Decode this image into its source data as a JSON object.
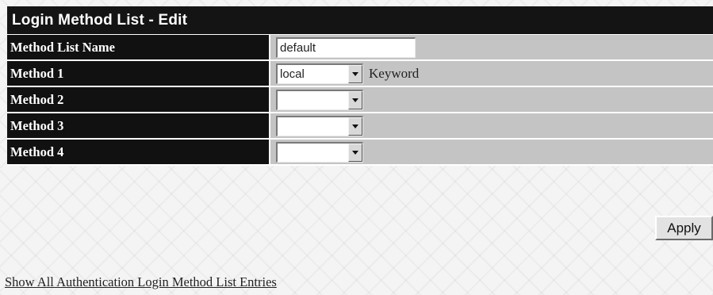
{
  "panel": {
    "title": "Login Method List - Edit"
  },
  "form": {
    "method_list_name": {
      "label": "Method List Name",
      "value": "default"
    },
    "methods": [
      {
        "label": "Method 1",
        "value": "local",
        "suffix": "Keyword"
      },
      {
        "label": "Method 2",
        "value": ""
      },
      {
        "label": "Method 3",
        "value": ""
      },
      {
        "label": "Method 4",
        "value": ""
      }
    ]
  },
  "actions": {
    "apply_label": "Apply"
  },
  "links": {
    "show_all": "Show All Authentication Login Method List Entries"
  },
  "colors": {
    "label_background": "#111111",
    "value_background": "#c4c4c4",
    "title_background": "#141414",
    "page_background": "#f4f4f4"
  }
}
